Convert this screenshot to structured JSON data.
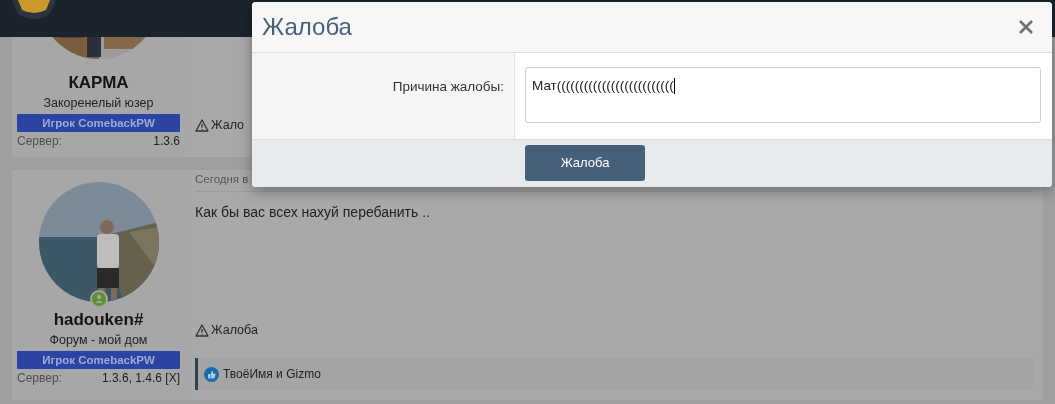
{
  "posts": [
    {
      "author": "КАРМА",
      "user_title": "Закоренелый юзер",
      "badge": "Игрок ComebackPW",
      "server_label": "Сервер:",
      "server_value": "1.3.6",
      "report": "Жало"
    },
    {
      "author": "hadouken#",
      "user_title": "Форум - мой дом",
      "badge": "Игрок ComebackPW",
      "server_label": "Сервер:",
      "server_value": "1.3.6, 1.4.6 [X]",
      "online": true,
      "date": "Сегодня в",
      "message": "Как бы вас всех нахуй перебанить ..",
      "report": "Жалоба",
      "likes": "ТвоёИмя и Gizmo"
    }
  ],
  "dialog": {
    "title": "Жалоба",
    "field_label": "Причина жалобы:",
    "field_value": "Мат((((((((((((((((((((((((((",
    "submit": "Жалоба"
  }
}
